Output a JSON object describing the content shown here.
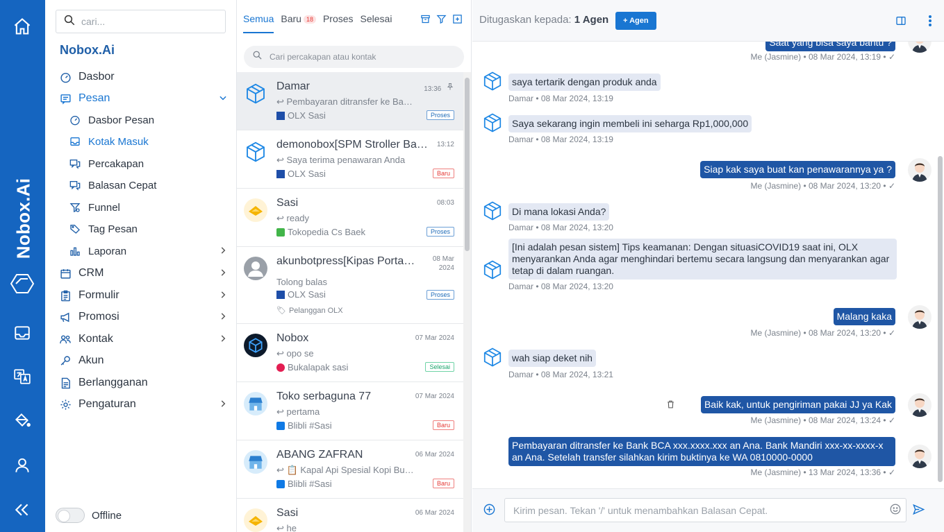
{
  "rail": {
    "brand": "Nobox.Ai",
    "icons": [
      "home-icon",
      "inbox-icon",
      "translate-icon",
      "paint-bucket-icon",
      "user-icon",
      "collapse-icon"
    ]
  },
  "sidebar": {
    "search_placeholder": "cari...",
    "title": "Nobox.Ai",
    "items": [
      {
        "label": "Dasbor"
      },
      {
        "label": "Pesan"
      },
      {
        "label": "Dasbor Pesan"
      },
      {
        "label": "Kotak Masuk"
      },
      {
        "label": "Percakapan"
      },
      {
        "label": "Balasan Cepat"
      },
      {
        "label": "Funnel"
      },
      {
        "label": "Tag Pesan"
      },
      {
        "label": "Laporan"
      },
      {
        "label": "CRM"
      },
      {
        "label": "Formulir"
      },
      {
        "label": "Promosi"
      },
      {
        "label": "Kontak"
      },
      {
        "label": "Akun"
      },
      {
        "label": "Berlangganan"
      },
      {
        "label": "Pengaturan"
      }
    ],
    "status_label": "Offline"
  },
  "conversations": {
    "tabs": [
      "Semua",
      "Baru",
      "Proses",
      "Selesai"
    ],
    "baru_count": "18",
    "search_placeholder": "Cari percakapan atau kontak",
    "items": [
      {
        "name": "Damar",
        "time": "13:36",
        "preview": "Pembayaran ditransfer ke Bank BCA xxx.xxxx.xxx",
        "source": "OLX Sasi",
        "status": "Proses"
      },
      {
        "name": "demonobox[SPM Stroller Baby]",
        "time": "13:12",
        "preview": "Saya terima penawaran Anda",
        "source": "OLX Sasi",
        "status": "Baru"
      },
      {
        "name": "Sasi",
        "time": "08:03",
        "preview": "ready",
        "source": "Tokopedia Cs Baek",
        "status": "Proses"
      },
      {
        "name": "akunbotpress[Kipas Portable]",
        "time": "08 Mar 2024",
        "preview": "Tolong balas",
        "source": "OLX Sasi",
        "status": "Proses",
        "tag": "Pelanggan OLX"
      },
      {
        "name": "Nobox",
        "time": "07 Mar 2024",
        "preview": "opo se",
        "source": "Bukalapak sasi",
        "status": "Selesai"
      },
      {
        "name": "Toko serbaguna 77",
        "time": "07 Mar 2024",
        "preview": "pertama",
        "source": "Blibli #Sasi",
        "status": "Baru"
      },
      {
        "name": "ABANG ZAFRAN",
        "time": "06 Mar 2024",
        "preview": "📋 Kapal Api Spesial Kopi Bubuk",
        "source": "Blibli #Sasi",
        "status": "Baru"
      },
      {
        "name": "Sasi",
        "time": "06 Mar 2024",
        "preview": "he",
        "source": "",
        "status": ""
      }
    ]
  },
  "chat": {
    "assigned_label": "Ditugaskan kepada:",
    "assigned_value": "1 Agen",
    "add_agent": "+ Agen",
    "messages": [
      {
        "dir": "out",
        "text": "Saat yang bisa saya bantu ?",
        "meta": "Me (Jasmine) • 08 Mar 2024, 13:19 • ✓"
      },
      {
        "dir": "in",
        "text": "saya tertarik dengan produk anda",
        "meta": "Damar • 08 Mar 2024, 13:19"
      },
      {
        "dir": "in",
        "text": "Saya sekarang ingin membeli ini seharga Rp1,000,000",
        "meta": "Damar • 08 Mar 2024, 13:19"
      },
      {
        "dir": "out",
        "text": "Siap kak saya buat kan penawarannya ya ?",
        "meta": "Me (Jasmine) • 08 Mar 2024, 13:20 • ✓"
      },
      {
        "dir": "in",
        "text": "Di mana lokasi Anda?",
        "meta": "Damar • 08 Mar 2024, 13:20"
      },
      {
        "dir": "in",
        "text": "[Ini adalah pesan sistem] Tips keamanan: Dengan situasiCOVID19 saat ini, OLX menyarankan Anda agar menghindari bertemu secara langsung dan menyarankan agar tetap di dalam ruangan.",
        "meta": "Damar • 08 Mar 2024, 13:20"
      },
      {
        "dir": "out",
        "text": "Malang kaka",
        "meta": "Me (Jasmine) • 08 Mar 2024, 13:20 • ✓"
      },
      {
        "dir": "in",
        "text": "wah siap deket nih",
        "meta": "Damar • 08 Mar 2024, 13:21"
      },
      {
        "dir": "out",
        "text": "Baik kak, untuk pengiriman pakai JJ ya Kak",
        "meta": "Me (Jasmine) • 08 Mar 2024, 13:24 • ✓"
      },
      {
        "dir": "out",
        "text": "Pembayaran ditransfer ke Bank BCA xxx.xxxx.xxx an Ana. Bank Mandiri xxx-xx-xxxx-x an Ana. Setelah transfer silahkan kirim buktinya ke WA 0810000-0000",
        "meta": "Me (Jasmine) • 13 Mar 2024, 13:36 • ✓"
      }
    ],
    "composer_placeholder": "Kirim pesan. Tekan '/' untuk menambahkan Balasan Cepat."
  },
  "colors": {
    "brand": "#1565c0",
    "accent": "#1976d2",
    "bubble_out": "#1f56a5",
    "bubble_in": "#e3e8f3"
  }
}
